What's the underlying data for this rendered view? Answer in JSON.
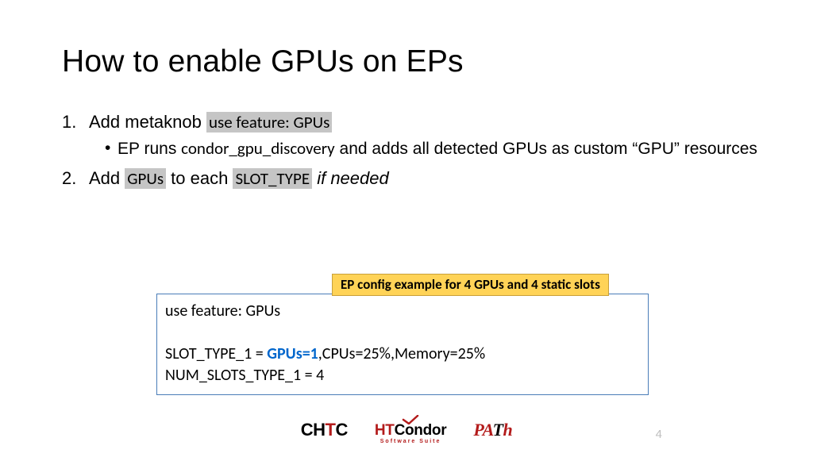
{
  "title": "How to enable GPUs on EPs",
  "list": {
    "item1": {
      "num": "1.",
      "prefix": "Add metaknob ",
      "code": "use feature: GPUs"
    },
    "sub1": {
      "bullet": "•",
      "a": "EP runs ",
      "cmd": "condor_gpu_discovery",
      "b": " and adds all detected GPUs as custom “GPU” resources"
    },
    "item2": {
      "num": "2.",
      "a": "Add ",
      "code1": "GPUs",
      "b": " to each ",
      "code2": "SLOT_TYPE",
      "c": " ",
      "italic": "if needed"
    }
  },
  "callout": "EP config example for 4 GPUs and 4 static slots",
  "config": {
    "l1": "use feature: GPUs",
    "l2a": "SLOT_TYPE_1 = ",
    "l2b": "GPUs=1",
    "l2c": ",CPUs=25%,Memory=25%",
    "l3": "NUM_SLOTS_TYPE_1 = 4"
  },
  "page": "4",
  "logos": {
    "chtc": {
      "a": "CH",
      "b": "T",
      "c": "C"
    },
    "htc": {
      "ht": "HT",
      "rest": "Condor",
      "sub": "Software Suite"
    },
    "path": {
      "a": "PA",
      "b": "T",
      "c": "h"
    }
  }
}
